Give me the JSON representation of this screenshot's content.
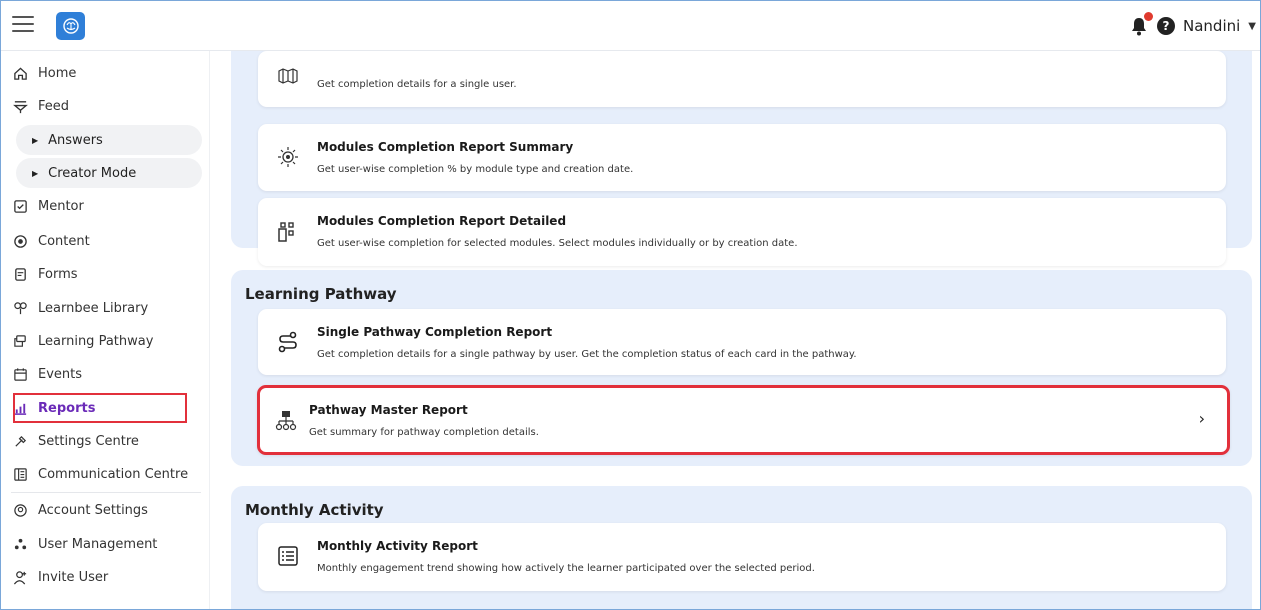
{
  "header": {
    "user_name": "Nandini",
    "help_glyph": "?",
    "icons": [
      "menu-icon",
      "brain-logo-icon",
      "bell-icon",
      "help-icon",
      "caret-down-icon"
    ],
    "brand_color": "#2f7fd8",
    "notification_color": "#e03b2f"
  },
  "sidebar": {
    "items": [
      {
        "label": "Home",
        "icon": "home-icon"
      },
      {
        "label": "Feed",
        "icon": "feed-icon"
      },
      {
        "label": "Answers",
        "icon": "caret-right-icon"
      },
      {
        "label": "Creator Mode",
        "icon": "caret-right-icon"
      },
      {
        "label": "Mentor",
        "icon": "checkbox-icon"
      },
      {
        "label": "Content",
        "icon": "content-icon"
      },
      {
        "label": "Forms",
        "icon": "forms-icon"
      },
      {
        "label": "Learnbee Library",
        "icon": "library-icon"
      },
      {
        "label": "Learning Pathway",
        "icon": "pathway-icon"
      },
      {
        "label": "Events",
        "icon": "calendar-icon"
      },
      {
        "label": "Reports",
        "icon": "reports-icon"
      },
      {
        "label": "Settings Centre",
        "icon": "settings-icon"
      },
      {
        "label": "Communication Centre",
        "icon": "communication-icon"
      },
      {
        "label": "Account Settings",
        "icon": "account-icon"
      },
      {
        "label": "User Management",
        "icon": "users-icon"
      },
      {
        "label": "Invite User",
        "icon": "invite-icon"
      }
    ],
    "active_color": "#6b2bb8",
    "highlight_color": "#e2303b"
  },
  "main": {
    "sections": [
      {
        "title": "",
        "cards": [
          {
            "title": "",
            "desc": "Get completion details for a single user.",
            "icon": "grid-icon"
          },
          {
            "title": "Modules Completion Report Summary",
            "desc": "Get user-wise completion % by module type and creation date.",
            "icon": "modules-icon"
          },
          {
            "title": "Modules Completion Report Detailed",
            "desc": "Get user-wise completion for selected modules. Select modules individually or by creation date.",
            "icon": "modules-detailed-icon"
          }
        ]
      },
      {
        "title": "Learning Pathway",
        "cards": [
          {
            "title": "Single Pathway Completion Report",
            "desc": "Get completion details for a single pathway by user. Get the completion status of each card in the pathway.",
            "icon": "route-icon"
          },
          {
            "title": "Pathway Master Report",
            "desc": "Get summary for pathway completion details.",
            "icon": "org-chart-icon",
            "chevron": "›"
          }
        ]
      },
      {
        "title": "Monthly Activity",
        "cards": [
          {
            "title": "Monthly Activity Report",
            "desc": "Monthly engagement trend showing how actively the learner participated over the selected period.",
            "icon": "list-icon"
          }
        ]
      }
    ],
    "section_bg": "#e6eefb"
  }
}
